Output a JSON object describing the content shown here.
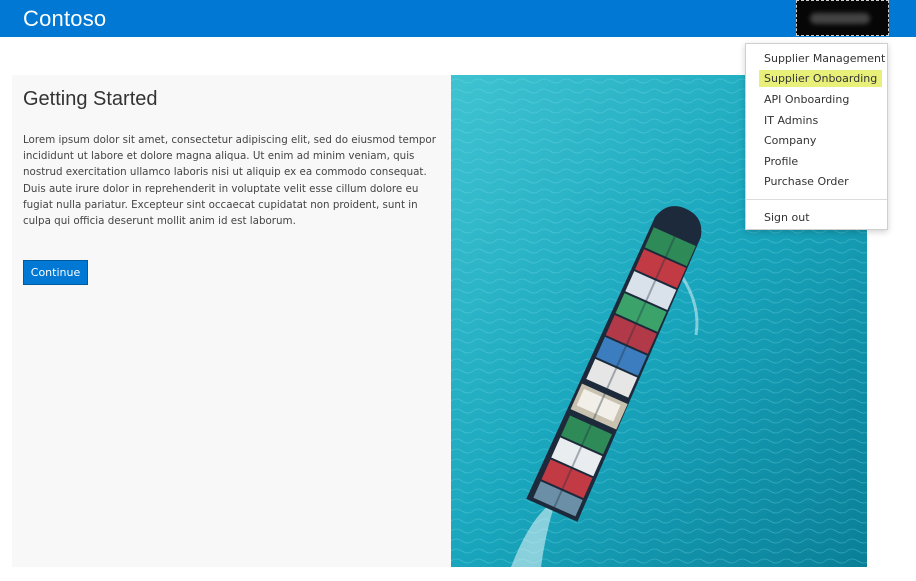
{
  "header": {
    "brand": "Contoso",
    "bg_color": "#0078d4"
  },
  "main": {
    "title": "Getting Started",
    "body": "Lorem ipsum dolor sit amet, consectetur adipiscing elit, sed do eiusmod tempor incididunt ut labore et dolore magna aliqua. Ut enim ad minim veniam, quis nostrud exercitation ullamco laboris nisi ut aliquip ex ea commodo consequat. Duis aute irure dolor in reprehenderit in voluptate velit esse cillum dolore eu fugiat nulla pariatur. Excepteur sint occaecat cupidatat non proident, sunt in culpa qui officia deserunt mollit anim id est laborum.",
    "button_label": "Continue",
    "button_color": "#0078d4"
  },
  "image": {
    "icon": "cargo-ship-image"
  },
  "user_menu": {
    "items": [
      {
        "label": "Supplier Management"
      },
      {
        "label": "Supplier Onboarding",
        "highlighted": true
      },
      {
        "label": "API Onboarding"
      },
      {
        "label": "IT Admins"
      },
      {
        "label": "Company"
      },
      {
        "label": "Profile"
      },
      {
        "label": "Purchase Order"
      }
    ],
    "sign_out": "Sign out",
    "highlight_color": "#e8f07a"
  }
}
